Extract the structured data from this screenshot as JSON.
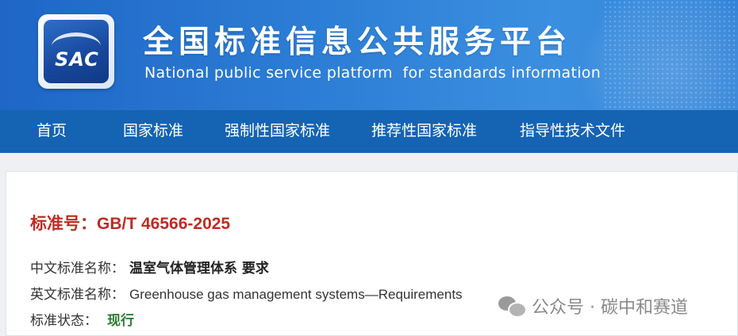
{
  "header": {
    "logo_text": "SAC",
    "title_cn": "全国标准信息公共服务平台",
    "title_en": "National public service platform  for standards information"
  },
  "nav": {
    "items": [
      {
        "label": "首页"
      },
      {
        "label": "国家标准"
      },
      {
        "label": "强制性国家标准"
      },
      {
        "label": "推荐性国家标准"
      },
      {
        "label": "指导性技术文件"
      }
    ]
  },
  "standard": {
    "number_line": "标准号：GB/T 46566-2025",
    "cn_name_label": "中文标准名称：",
    "cn_name_value": "温室气体管理体系 要求",
    "en_name_label": "英文标准名称：",
    "en_name_value": "Greenhouse gas management systems—Requirements",
    "status_label": "标准状态：",
    "status_value": "现行"
  },
  "watermark": {
    "text": "公众号 · 碳中和赛道",
    "icon": "wechat-icon"
  },
  "colors": {
    "banner": "#2d7fd6",
    "nav": "#1563b3",
    "standard_number": "#bf2b23",
    "status_current": "#2e7d32"
  }
}
